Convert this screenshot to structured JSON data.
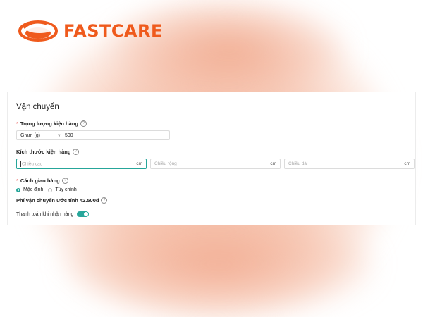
{
  "brand": {
    "name": "FASTCARE",
    "color": "#ef5a1c"
  },
  "panel": {
    "title": "Vận chuyển",
    "weight": {
      "label": "Trọng lượng kiện hàng",
      "required": "*",
      "unit": "Gram (g)",
      "value": "500"
    },
    "dimensions": {
      "label": "Kích thước kiện hàng",
      "fields": [
        {
          "placeholder": "Chiều cao",
          "unit": "cm"
        },
        {
          "placeholder": "Chiều rộng",
          "unit": "cm"
        },
        {
          "placeholder": "Chiều dài",
          "unit": "cm"
        }
      ]
    },
    "delivery": {
      "label": "Cách giao hàng",
      "required": "*",
      "options": [
        "Mặc định",
        "Tùy chỉnh"
      ],
      "selected": "Mặc định"
    },
    "fee_text": "Phí vận chuyển ước tính 42.500đ",
    "cod": {
      "label": "Thanh toán khi nhận hàng",
      "enabled": true
    }
  },
  "colors": {
    "accent": "#26a69a",
    "required": "#e53935"
  }
}
